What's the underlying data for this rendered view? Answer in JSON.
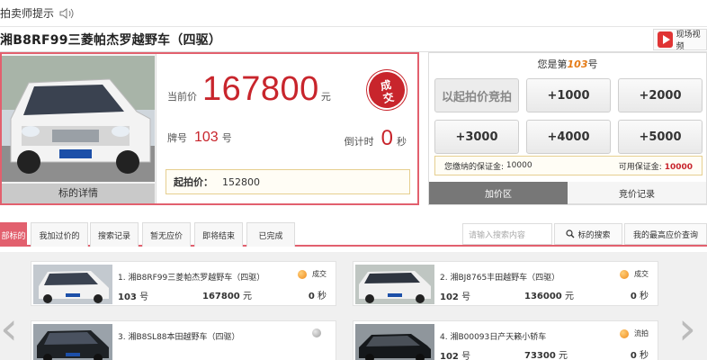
{
  "notice": {
    "text": "拍卖师提示"
  },
  "header": {
    "title": "湘B8RF99三菱帕杰罗越野车（四驱）",
    "video_label": "现场视频"
  },
  "detail": {
    "photo_caption": "标的详情",
    "current_price_label": "当前价",
    "current_price": "167800",
    "price_unit": "元",
    "stamp_text_1": "成",
    "stamp_text_2": "交",
    "plate_label": "牌号",
    "plate_number": "103",
    "plate_unit": "号",
    "countdown_label": "倒计时",
    "countdown_value": "0",
    "countdown_unit": "秒",
    "start_price_label": "起拍价：",
    "start_price_value": "152800"
  },
  "bid": {
    "header_prefix": "您是第",
    "rank": "103",
    "header_suffix": "号",
    "buttons": [
      "以起拍价竞拍",
      "+1000",
      "+2000",
      "+3000",
      "+4000",
      "+5000"
    ],
    "deposit_label": "您缴纳的保证金:",
    "deposit_value": "10000",
    "available_label": "可用保证金:",
    "available_value": "10000",
    "tabs": [
      "加价区",
      "竞价记录"
    ]
  },
  "filters": {
    "tabs": [
      "部标的",
      "我加过价的",
      "搜索记录",
      "暂无应价",
      "即将结束",
      "已完成"
    ],
    "search_placeholder": "请输入搜索内容",
    "search_button": "标的搜索",
    "my_price_button": "我的最高应价查询"
  },
  "listings": [
    {
      "name": "1. 湘B8RF99三菱帕杰罗越野车（四驱）",
      "status": "成交",
      "status_color": "#ef8a1a",
      "lot": "103",
      "lot_unit": "号",
      "price": "167800",
      "price_unit": "元",
      "time": "0",
      "time_unit": "秒"
    },
    {
      "name": "2. 湘BJ8765丰田越野车（四驱）",
      "status": "成交",
      "status_color": "#ef8a1a",
      "lot": "102",
      "lot_unit": "号",
      "price": "136000",
      "price_unit": "元",
      "time": "0",
      "time_unit": "秒"
    },
    {
      "name": "3. 湘B8SL88本田越野车（四驱）",
      "status": "",
      "status_color": "#9c9c9c",
      "lot": "",
      "lot_unit": "",
      "price": "",
      "price_unit": "",
      "time": "",
      "time_unit": ""
    },
    {
      "name": "4. 湘B00093日产天籁小轿车",
      "status": "流拍",
      "status_color": "#ef8a1a",
      "lot": "102",
      "lot_unit": "号",
      "price": "73300",
      "price_unit": "元",
      "time": "0",
      "time_unit": "秒"
    }
  ]
}
